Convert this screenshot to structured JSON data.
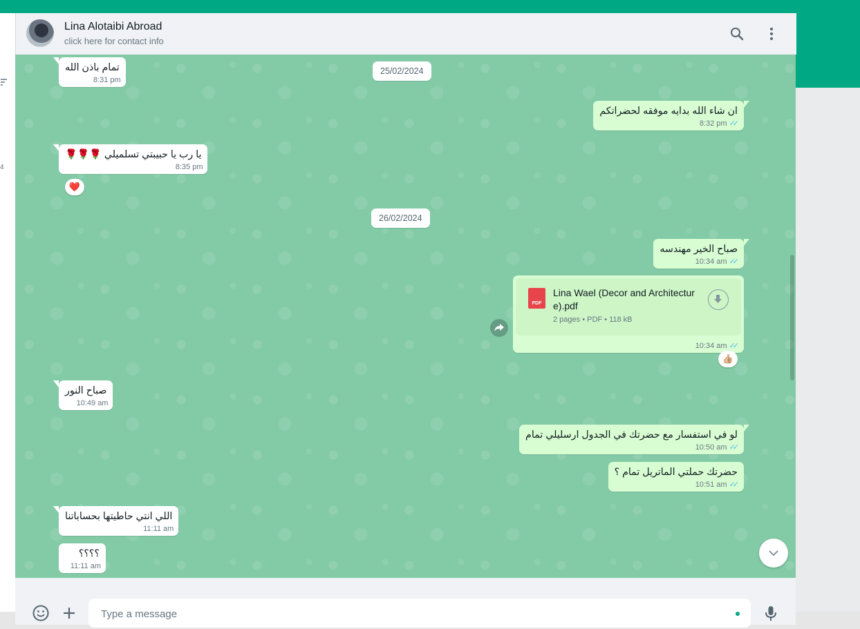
{
  "header": {
    "contact_name": "Lina Alotaibi Abroad",
    "contact_sub": "click here for contact info",
    "icons": [
      "search-icon",
      "menu-icon"
    ]
  },
  "sidebar": {
    "count": "4"
  },
  "messages": {
    "dates": [
      "25/02/2024",
      "26/02/2024"
    ],
    "items": [
      {
        "dir": "in",
        "text": "تمام باذن الله",
        "time": "8:31 pm"
      },
      {
        "dir": "out",
        "text": "ان شاء الله بدايه موفقه لحضراتكم",
        "time": "8:32 pm",
        "status": "read"
      },
      {
        "dir": "in",
        "text": "يا رب يا حبيبتي تسلميلي 🌹🌹🌹",
        "time": "8:35 pm",
        "reaction": "❤️"
      },
      {
        "dir": "out",
        "text": "صباح الخير مهندسه",
        "time": "10:34 am",
        "status": "read"
      },
      {
        "dir": "out",
        "type": "document",
        "file_name": "Lina Wael (Decor and Architecture).pdf",
        "file_info": "2 pages • PDF • 118 kB",
        "icon_label": "PDF",
        "time": "10:34 am",
        "status": "read",
        "reaction": "👍🏼"
      },
      {
        "dir": "in",
        "text": "صباح النور",
        "time": "10:49 am"
      },
      {
        "dir": "out",
        "text": "لو في استفسار مع حضرتك في الجدول ارسليلي تمام",
        "time": "10:50 am",
        "status": "read"
      },
      {
        "dir": "out",
        "text": "حضرتك حملتي الماتريل تمام ؟",
        "time": "10:51 am",
        "status": "read"
      },
      {
        "dir": "in",
        "text": "اللي انتي حاطيتها بحساباتنا",
        "time": "11:11 am"
      },
      {
        "dir": "in",
        "text": "؟؟؟؟",
        "time": "11:11 am"
      }
    ]
  },
  "composer": {
    "placeholder": "Type a message"
  },
  "colors": {
    "accent": "#00a884",
    "wallpaper": "#83cba7",
    "outgoing": "#d9fdd3",
    "incoming": "#ffffff",
    "tick": "#53bdeb"
  }
}
